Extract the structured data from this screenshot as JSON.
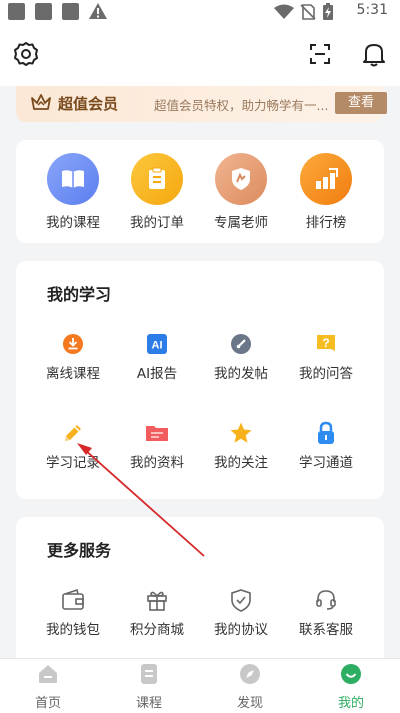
{
  "status_bar": {
    "time": "5:31"
  },
  "header": {
    "settings_icon": "gear-icon",
    "scan_icon": "scan-icon",
    "notification_icon": "bell-icon"
  },
  "vip_banner": {
    "title": "超值会员",
    "description": "超值会员特权，助力畅学有一...",
    "button": "查看"
  },
  "quick_actions": [
    {
      "label": "我的课程",
      "icon": "book-icon",
      "color": "#6e8ef5"
    },
    {
      "label": "我的订单",
      "icon": "order-icon",
      "color": "#f7b41c"
    },
    {
      "label": "专属老师",
      "icon": "teacher-icon",
      "color": "#e7a276"
    },
    {
      "label": "排行榜",
      "icon": "ranking-icon",
      "color": "#f4901e"
    }
  ],
  "my_study": {
    "title": "我的学习",
    "items": [
      {
        "label": "离线课程",
        "icon": "download-icon"
      },
      {
        "label": "AI报告",
        "icon": "ai-report-icon"
      },
      {
        "label": "我的发帖",
        "icon": "post-icon"
      },
      {
        "label": "我的问答",
        "icon": "question-icon"
      },
      {
        "label": "学习记录",
        "icon": "pencil-icon"
      },
      {
        "label": "我的资料",
        "icon": "folder-icon"
      },
      {
        "label": "我的关注",
        "icon": "star-icon"
      },
      {
        "label": "学习通道",
        "icon": "lock-icon"
      }
    ]
  },
  "more_services": {
    "title": "更多服务",
    "items": [
      {
        "label": "我的钱包",
        "icon": "wallet-icon"
      },
      {
        "label": "积分商城",
        "icon": "gift-icon"
      },
      {
        "label": "我的协议",
        "icon": "shield-check-icon"
      },
      {
        "label": "联系客服",
        "icon": "headset-icon"
      }
    ]
  },
  "tab_bar": {
    "tabs": [
      {
        "label": "首页",
        "icon": "home-icon",
        "active": false
      },
      {
        "label": "课程",
        "icon": "course-icon",
        "active": false
      },
      {
        "label": "发现",
        "icon": "discover-icon",
        "active": false
      },
      {
        "label": "我的",
        "icon": "profile-icon",
        "active": true
      }
    ],
    "active_color": "#2eae62"
  },
  "annotation": {
    "color": "#d62828"
  }
}
